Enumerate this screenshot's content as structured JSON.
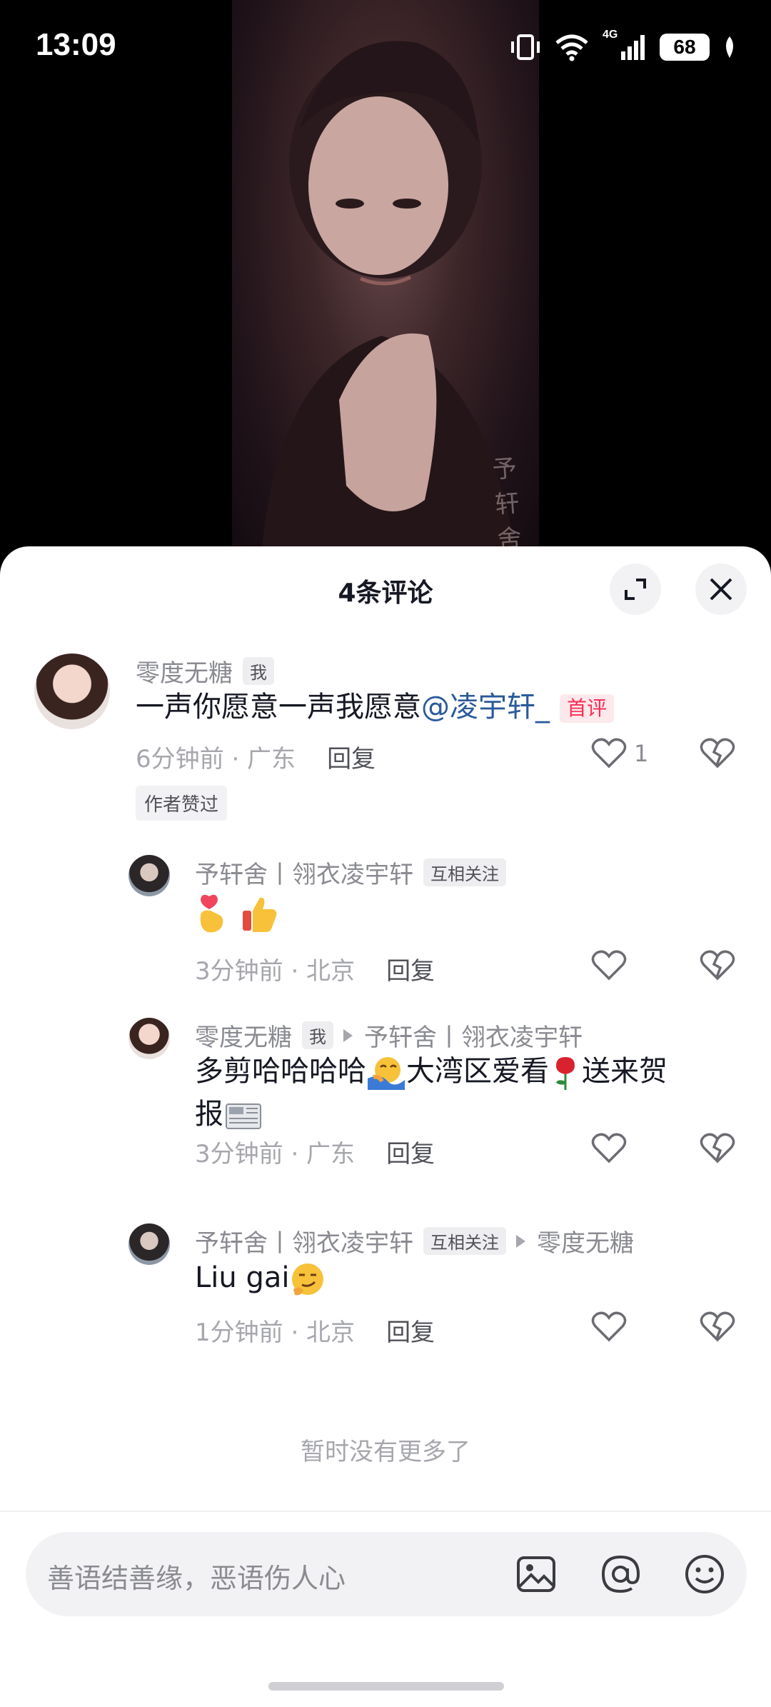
{
  "status_bar": {
    "time": "13:09",
    "network": "4G",
    "battery": "68"
  },
  "video": {
    "watermark": "予轩舍"
  },
  "sheet": {
    "title": "4条评论",
    "expand_icon": "expand-icon",
    "close_icon": "close-icon"
  },
  "comments": [
    {
      "author": "零度无糖",
      "author_tag": "我",
      "text": "一声你愿意一声我愿意",
      "mention": "@凌宇轩_",
      "badge": "首评",
      "meta": "6分钟前 · 广东",
      "reply": "回复",
      "likes": "1",
      "author_liked": "作者赞过"
    }
  ],
  "replies": [
    {
      "author": "予轩舍丨翎衣凌宇轩",
      "author_tag": "互相关注",
      "text": "",
      "emojis": [
        "finger-heart-emoji",
        "thumbs-up-emoji"
      ],
      "meta": "3分钟前 · 北京",
      "reply": "回复"
    },
    {
      "author": "零度无糖",
      "author_tag": "我",
      "reply_to": "予轩舍丨翎衣凌宇轩",
      "text_line1_a": "多剪哈哈哈哈",
      "text_line1_b": "大湾区爱看",
      "text_line1_c": "送来贺",
      "text_line2": "报",
      "emojis": [
        "hug-emoji",
        "rose-emoji",
        "newspaper-emoji"
      ],
      "meta": "3分钟前 · 广东",
      "reply": "回复"
    },
    {
      "author": "予轩舍丨翎衣凌宇轩",
      "author_tag": "互相关注",
      "reply_to": "零度无糖",
      "text": "Liu gai",
      "emojis": [
        "smirk-emoji"
      ],
      "meta": "1分钟前 · 北京",
      "reply": "回复"
    }
  ],
  "no_more": "暂时没有更多了",
  "input": {
    "placeholder": "善语结善缘，恶语伤人心",
    "icons": [
      "image-icon",
      "at-icon",
      "emoji-icon"
    ]
  },
  "colors": {
    "accent": "#fe2c55",
    "mention": "#2a5a9a",
    "secondary_text": "#8a8b91"
  }
}
